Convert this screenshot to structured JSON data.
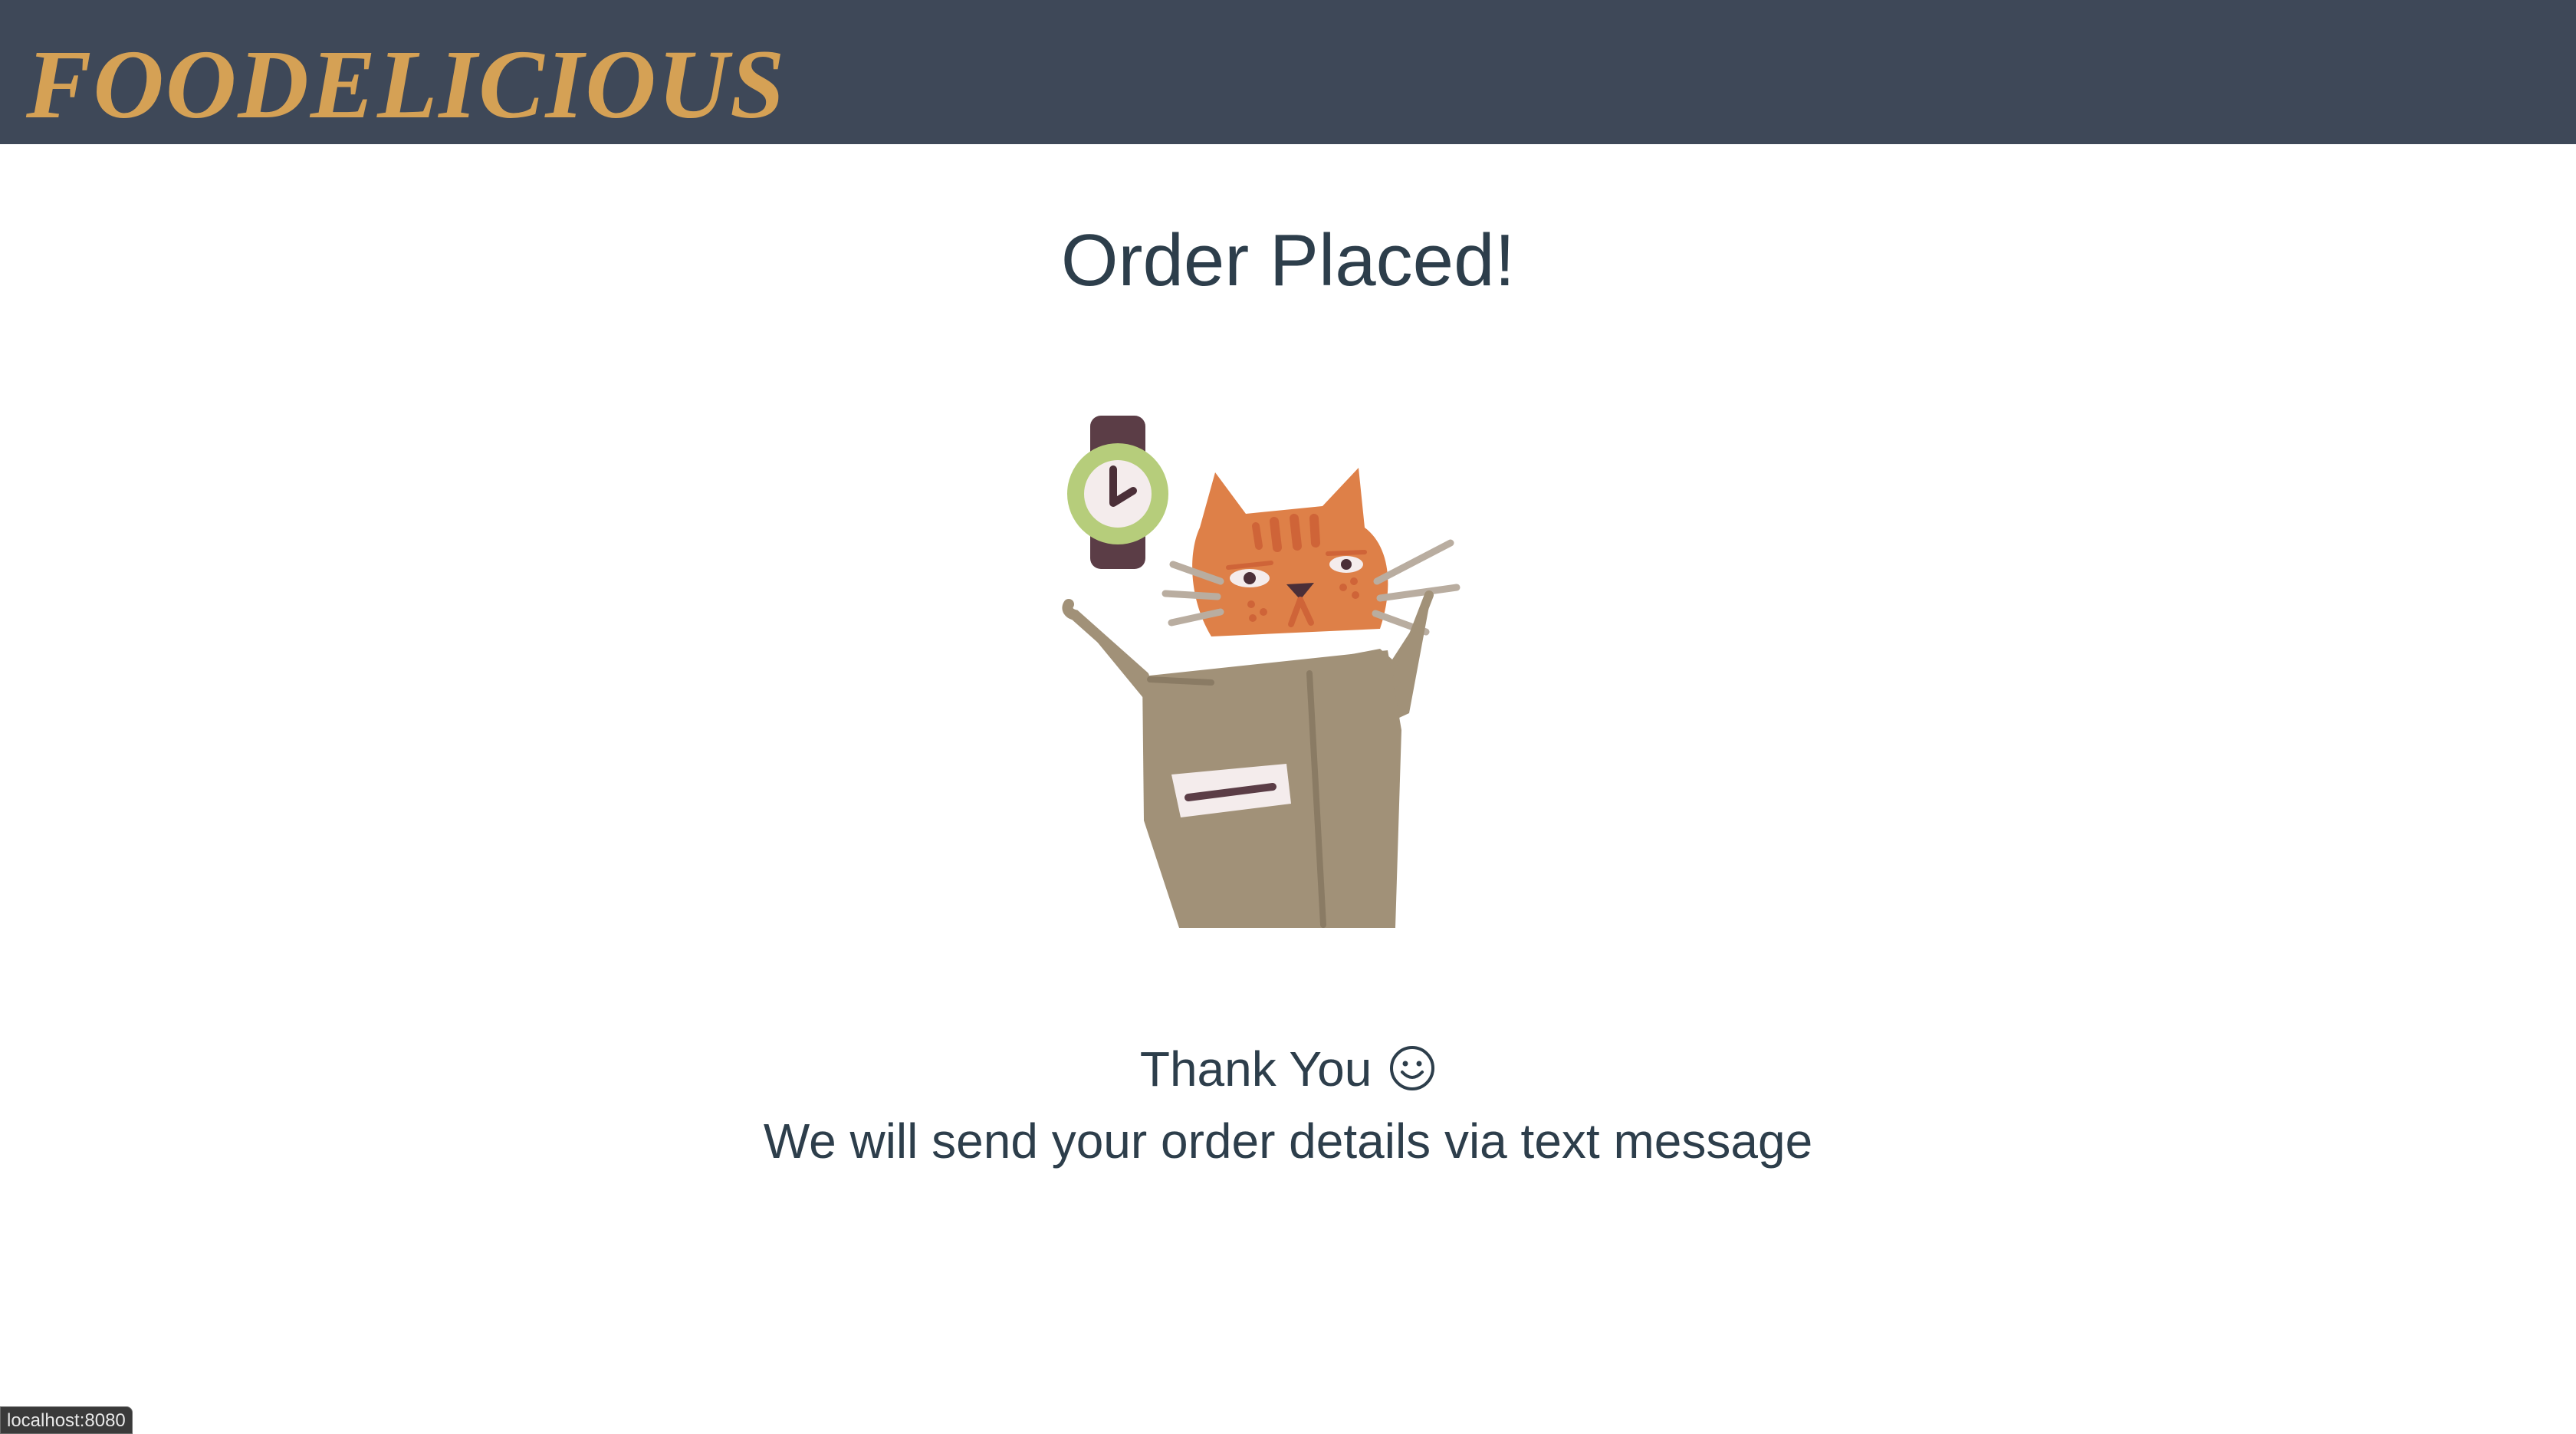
{
  "header": {
    "brand": "FOODELICIOUS",
    "background_color": "#3e4858",
    "brand_color": "#d5a155"
  },
  "main": {
    "title": "Order Placed!",
    "illustration": "cat-in-box-with-watch",
    "thank_you_text": "Thank You",
    "thank_you_icon": "smiley-face-icon",
    "message": "We will send your order details via text message"
  },
  "browser_status": {
    "url": "localhost:8080"
  }
}
